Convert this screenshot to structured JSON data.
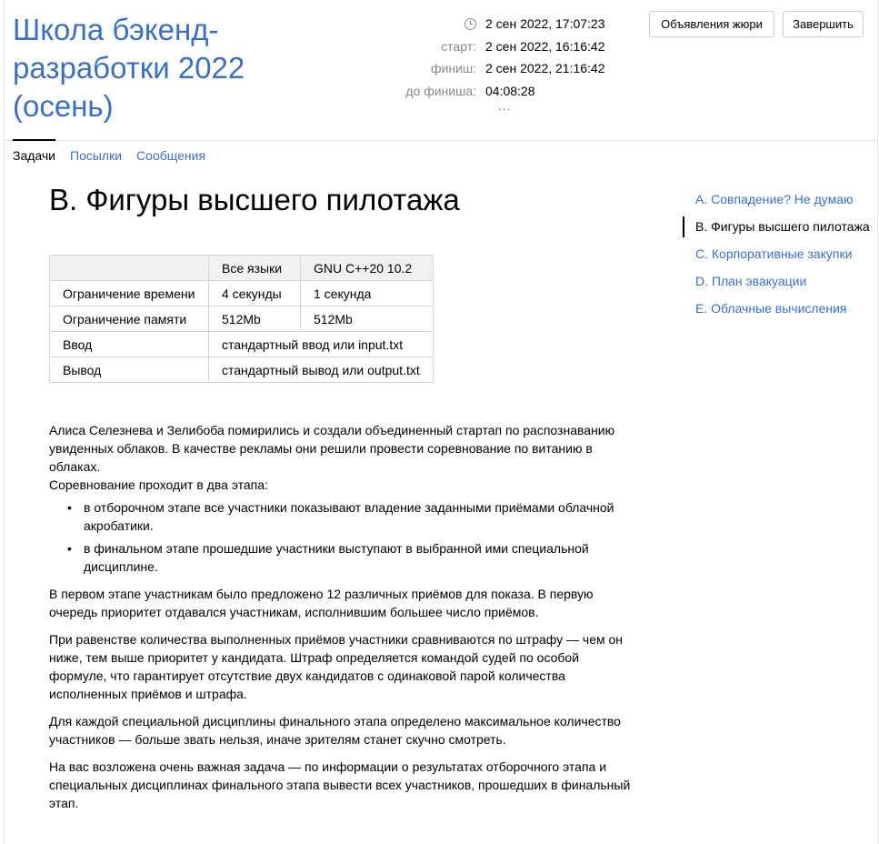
{
  "contest": {
    "title": "Школа бэкенд-разработки 2022 (осень)"
  },
  "times": {
    "current_time": "2 сен 2022, 17:07:23",
    "start_label": "старт:",
    "start": "2 сен 2022, 16:16:42",
    "finish_label": "финиш:",
    "finish": "2 сен 2022, 21:16:42",
    "remaining_label": "до финиша:",
    "remaining": "04:08:28",
    "more": "..."
  },
  "buttons": {
    "jury_announcements": "Объявления жюри",
    "finish": "Завершить"
  },
  "tabs": [
    {
      "label": "Задачи",
      "active": true
    },
    {
      "label": "Посылки",
      "active": false
    },
    {
      "label": "Сообщения",
      "active": false
    }
  ],
  "problem": {
    "title": "B. Фигуры высшего пилотажа",
    "limits": {
      "header": [
        "",
        "Все языки",
        "GNU C++20 10.2"
      ],
      "rows": [
        [
          "Ограничение времени",
          "4 секунды",
          "1 секунда"
        ],
        [
          "Ограничение памяти",
          "512Mb",
          "512Mb"
        ],
        [
          "Ввод",
          "стандартный ввод или input.txt"
        ],
        [
          "Вывод",
          "стандартный вывод или output.txt"
        ]
      ]
    },
    "statement": {
      "p1": "Алиса Селезнева и Зелибоба помирились и создали объединенный стартап по распознаванию увиденных облаков. В качестве рекламы они решили провести соревнование по витанию в облаках.",
      "p2": "Соревнование проходит в два этапа:",
      "bullets": [
        "в отборочном этапе все участники показывают владение заданными приёмами облачной акробатики.",
        "в финальном этапе прошедшие участники выступают в выбранной ими специальной дисциплине."
      ],
      "p3": "В первом этапе участникам было предложено 12 различных приёмов для показа. В первую очередь приоритет отдавался участникам, исполнившим большее число приёмов.",
      "p4": "При равенстве количества выполненных приёмов участники сравниваются по штрафу — чем он ниже, тем выше приоритет у кандидата. Штраф определяется командой судей по особой формуле, что гарантирует отсутствие двух кандидатов с одинаковой парой количества исполненных приёмов и штрафа.",
      "p5": "Для каждой специальной дисциплины финального этапа определено максимальное количество участников — больше звать нельзя, иначе зрителям станет скучно смотреть.",
      "p6": "На вас возложена очень важная задача — по информации о результатах отборочного этапа и специальных дисциплинах финального этапа вывести всех участников, прошедших в финальный этап."
    }
  },
  "problem_list": [
    {
      "label": "A. Совпадение? Не думаю",
      "current": false
    },
    {
      "label": "B. Фигуры высшего пилотажа",
      "current": true
    },
    {
      "label": "C. Корпоративные закупки",
      "current": false
    },
    {
      "label": "D. План эвакуации",
      "current": false
    },
    {
      "label": "E. Облачные вычисления",
      "current": false
    }
  ],
  "colors": {
    "link": "#3a6fc2",
    "muted": "#888888",
    "table_header_bg": "#f1f1f1"
  }
}
